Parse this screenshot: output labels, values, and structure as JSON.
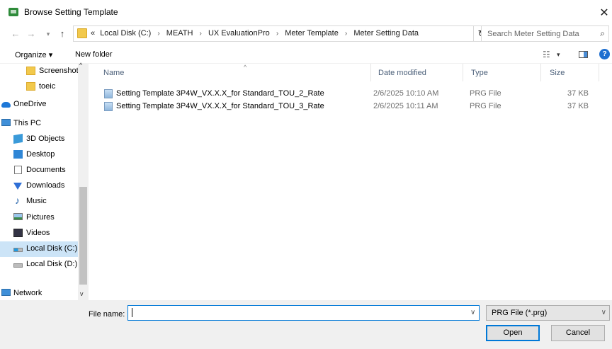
{
  "window": {
    "title": "Browse Setting Template",
    "close_glyph": "✕"
  },
  "nav": {
    "back": "←",
    "forward": "→",
    "recent": "▾",
    "up": "↑"
  },
  "address": {
    "prefix": "«",
    "crumbs": [
      "Local Disk (C:)",
      "MEATH",
      "UX EvaluationPro",
      "Meter Template",
      "Meter Setting Data"
    ],
    "separator": "›",
    "dropdown": "∨",
    "refresh": "↻"
  },
  "search": {
    "placeholder": "Search Meter Setting Data",
    "icon": "⌕"
  },
  "toolbar": {
    "organize": "Organize ▾",
    "new_folder": "New folder",
    "view_icon": "☷",
    "view_caret": "▾",
    "help": "?"
  },
  "sidebar": {
    "scroll_up": "^",
    "scroll_down": "v",
    "items": [
      {
        "label": "Screenshots",
        "icon": "folder-icon"
      },
      {
        "label": "toeic",
        "icon": "folder-icon"
      },
      {
        "label": "OneDrive",
        "icon": "cloud-icon"
      },
      {
        "label": "This PC",
        "icon": "computer-icon"
      },
      {
        "label": "3D Objects",
        "icon": "cube-icon"
      },
      {
        "label": "Desktop",
        "icon": "desktop-icon"
      },
      {
        "label": "Documents",
        "icon": "document-icon"
      },
      {
        "label": "Downloads",
        "icon": "download-icon"
      },
      {
        "label": "Music",
        "icon": "music-icon"
      },
      {
        "label": "Pictures",
        "icon": "picture-icon"
      },
      {
        "label": "Videos",
        "icon": "video-icon"
      },
      {
        "label": "Local Disk (C:)",
        "icon": "windows-disk-icon",
        "selected": true
      },
      {
        "label": "Local Disk (D:)",
        "icon": "disk-icon"
      },
      {
        "label": "Network",
        "icon": "network-icon"
      }
    ]
  },
  "filelist": {
    "columns": {
      "name": "Name",
      "date": "Date modified",
      "type": "Type",
      "size": "Size"
    },
    "sort_indicator": "^",
    "rows": [
      {
        "name": "Setting Template 3P4W_VX.X.X_for Standard_TOU_2_Rate",
        "date": "2/6/2025 10:10 AM",
        "type": "PRG File",
        "size": "37 KB"
      },
      {
        "name": "Setting Template 3P4W_VX.X.X_for Standard_TOU_3_Rate",
        "date": "2/6/2025 10:11 AM",
        "type": "PRG File",
        "size": "37 KB"
      }
    ]
  },
  "footer": {
    "file_name_label": "File name:",
    "file_name_value": "",
    "file_name_dropdown": "∨",
    "file_type": "PRG File (*.prg)",
    "file_type_dropdown": "∨",
    "open_label": "Open",
    "cancel_label": "Cancel"
  },
  "colors": {
    "selection": "#cce4f7",
    "accent": "#0078d7",
    "header_text": "#4c607a"
  }
}
